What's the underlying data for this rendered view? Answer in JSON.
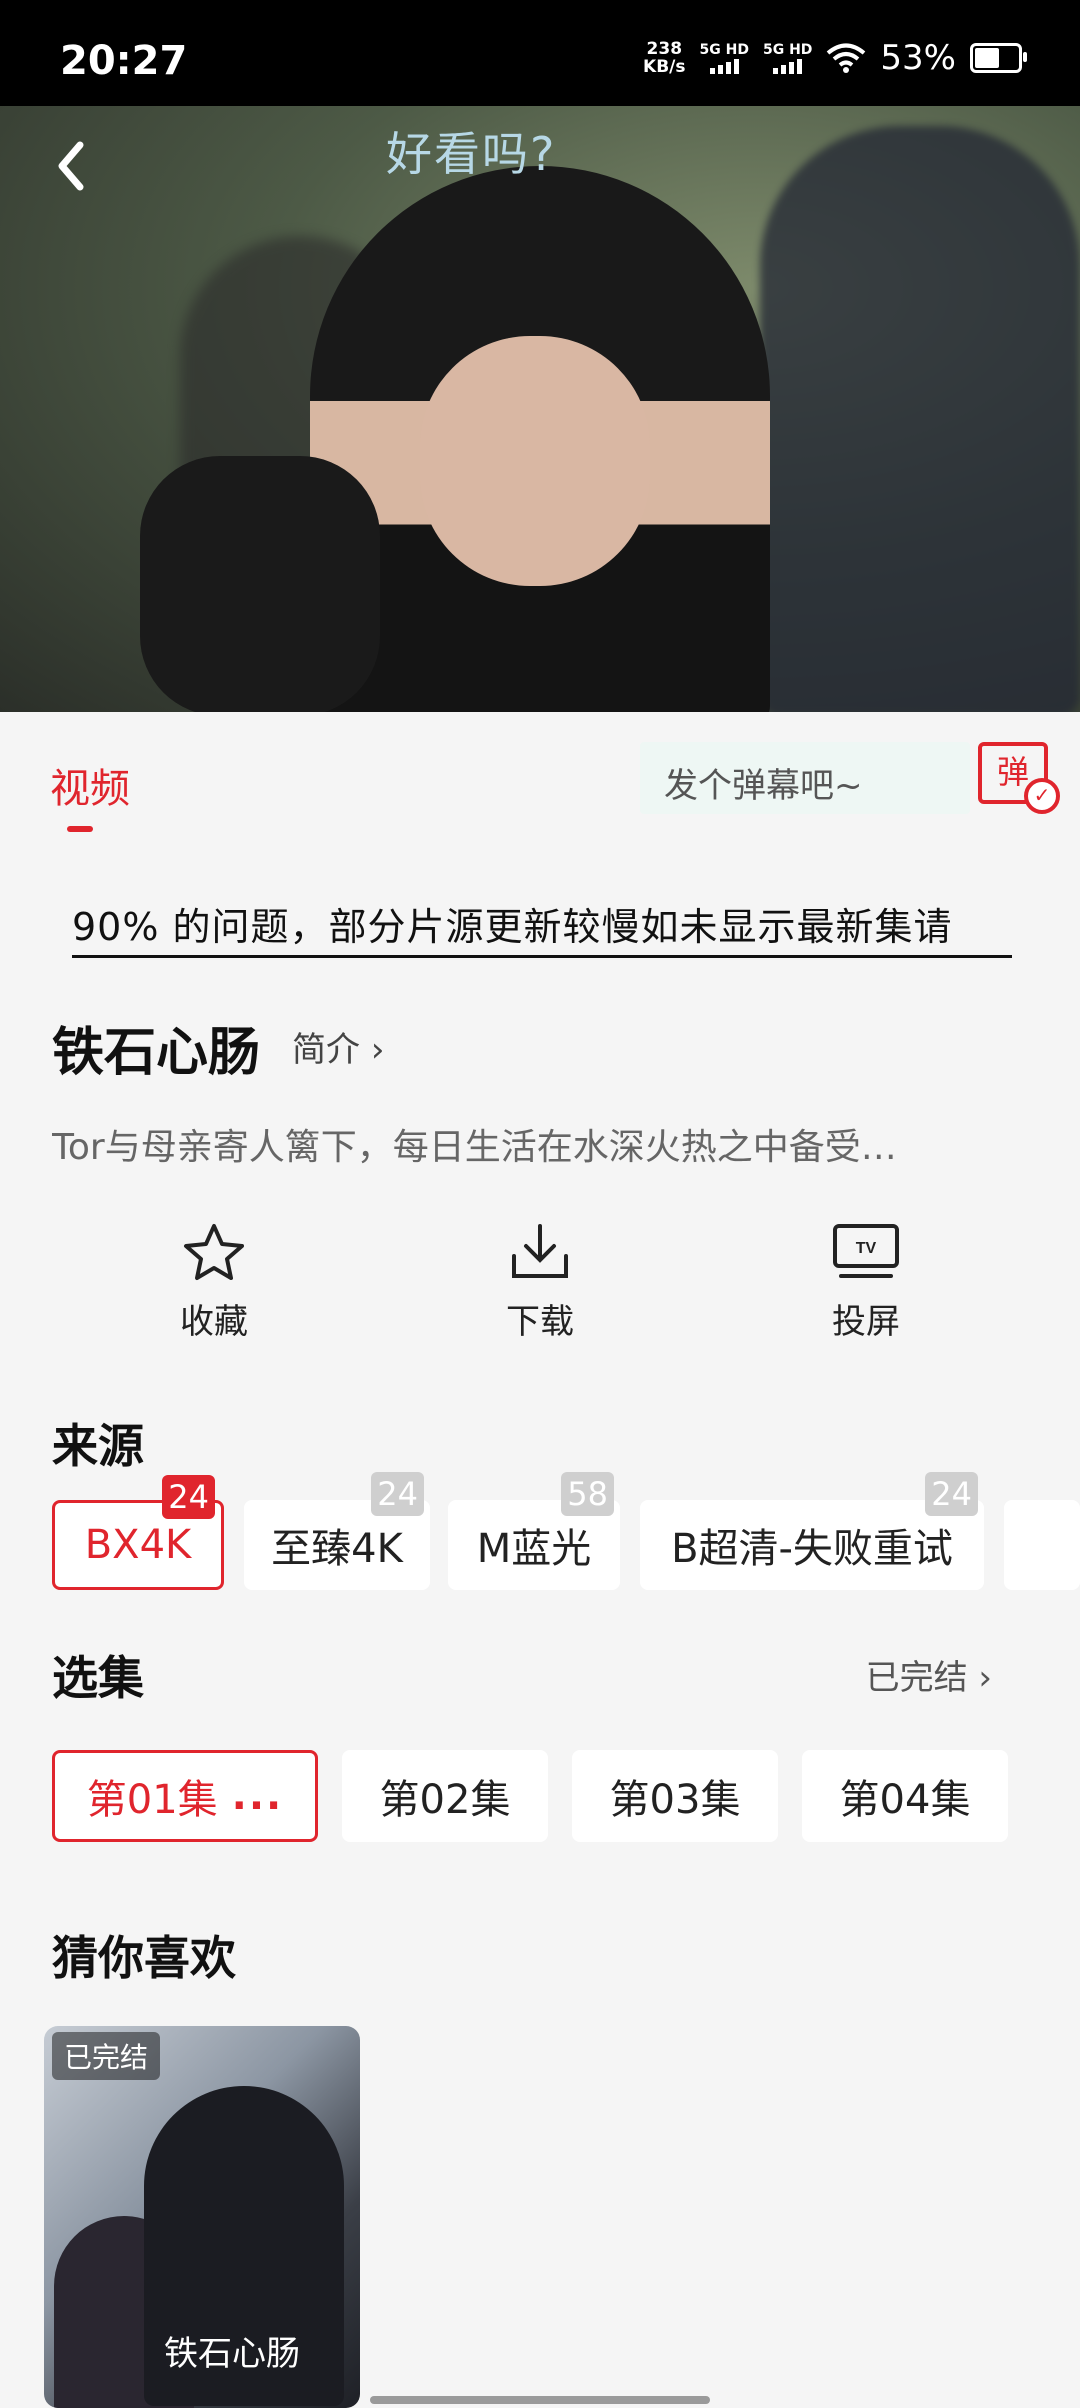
{
  "status_bar": {
    "time": "20:27",
    "net_speed": "238",
    "net_unit": "KB/s",
    "sim1": "5G HD",
    "sim2": "5G HD",
    "battery": "53%"
  },
  "player": {
    "subtitle": "好看吗?",
    "back_icon": "chevron-left-icon"
  },
  "tabs": {
    "video_label": "视频",
    "danmu_placeholder": "发个弹幕吧~",
    "danmu_button": "弹"
  },
  "notice_text": "90% 的问题，部分片源更新较慢如未显示最新集请",
  "show": {
    "title": "铁石心肠",
    "intro_label": "简介",
    "synopsis": "Tor与母亲寄人篱下，每日生活在水深火热之中备受…"
  },
  "actions": [
    {
      "icon": "star-icon",
      "label": "收藏"
    },
    {
      "icon": "download-icon",
      "label": "下载"
    },
    {
      "icon": "tv-cast-icon",
      "label": "投屏"
    }
  ],
  "sources": {
    "heading": "来源",
    "items": [
      {
        "label": "BX4K",
        "badge": "24",
        "active": true
      },
      {
        "label": "至臻4K",
        "badge": "24",
        "active": false
      },
      {
        "label": "M蓝光",
        "badge": "58",
        "active": false
      },
      {
        "label": "B超清-失败重试",
        "badge": "24",
        "active": false
      }
    ]
  },
  "episodes": {
    "heading": "选集",
    "status": "已完结",
    "items": [
      {
        "label": "第01集",
        "active": true,
        "dots": "..."
      },
      {
        "label": "第02集",
        "active": false
      },
      {
        "label": "第03集",
        "active": false
      },
      {
        "label": "第04集",
        "active": false
      }
    ]
  },
  "recommend": {
    "heading": "猜你喜欢",
    "cards": [
      {
        "tag": "已完结",
        "poster_text": "铁石心肠"
      }
    ]
  },
  "colors": {
    "accent": "#e0252d",
    "background": "#f5f5f5"
  }
}
